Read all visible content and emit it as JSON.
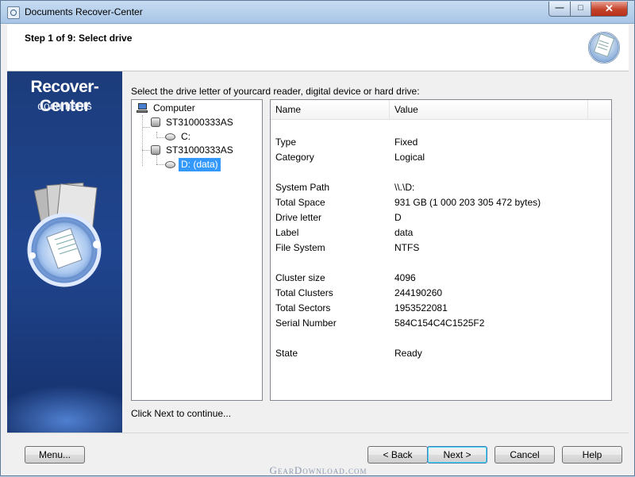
{
  "window": {
    "title": "Documents Recover-Center",
    "min_label": "—",
    "max_label": "□",
    "close_label": "✕"
  },
  "header": {
    "step": "Step 1 of 9: Select drive",
    "logo_icon": "document-globe-icon"
  },
  "banner": {
    "brand_line1": "Recover-Center",
    "brand_line2": "documents",
    "emblem_icon": "documents-ring-icon"
  },
  "instruction": "Select the drive letter of yourcard reader, digital device or hard drive:",
  "tree": {
    "root": {
      "label": "Computer",
      "icon": "computer-icon"
    },
    "disks": [
      {
        "label": "ST31000333AS",
        "icon": "hard-disk-icon",
        "volumes": [
          {
            "label": "C:",
            "icon": "volume-icon",
            "selected": false
          }
        ]
      },
      {
        "label": "ST31000333AS",
        "icon": "hard-disk-icon",
        "volumes": [
          {
            "label": "D: (data)",
            "icon": "volume-icon",
            "selected": true
          }
        ]
      }
    ]
  },
  "properties": {
    "columns": [
      "Name",
      "Value"
    ],
    "rows": [
      {
        "name": "Type",
        "value": "Fixed"
      },
      {
        "name": "Category",
        "value": "Logical"
      },
      {
        "name": "System Path",
        "value": "\\\\.\\D:"
      },
      {
        "name": "Total Space",
        "value": "931 GB (1 000 203 305 472 bytes)"
      },
      {
        "name": "Drive letter",
        "value": "D"
      },
      {
        "name": "Label",
        "value": "data"
      },
      {
        "name": "File System",
        "value": "NTFS"
      },
      {
        "name": "Cluster size",
        "value": "4096"
      },
      {
        "name": "Total Clusters",
        "value": "244190260"
      },
      {
        "name": "Total Sectors",
        "value": "1953522081"
      },
      {
        "name": "Serial Number",
        "value": "584C154C4C1525F2"
      },
      {
        "name": "State",
        "value": "Ready"
      }
    ]
  },
  "footer_note": "Click Next to continue...",
  "buttons": {
    "menu": "Menu...",
    "back": "< Back",
    "next": "Next >",
    "cancel": "Cancel",
    "help": "Help"
  },
  "watermark": "GearDownload.com",
  "colors": {
    "banner": "#20458f",
    "selection": "#3399ff",
    "close": "#c4422a"
  }
}
